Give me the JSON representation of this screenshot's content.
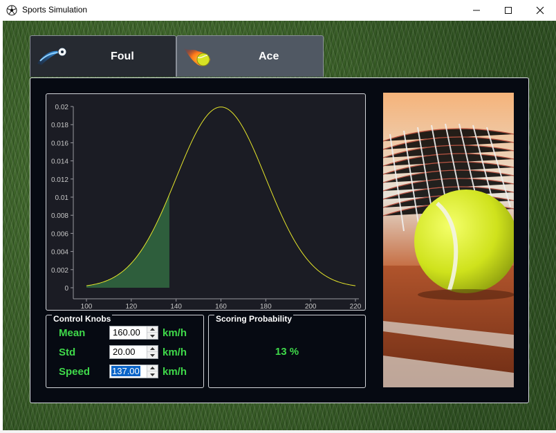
{
  "window": {
    "title": "Sports Simulation",
    "controls": [
      "minimize",
      "maximize",
      "close"
    ]
  },
  "tabs": [
    {
      "label": "Foul",
      "icon": "ball-comet-icon",
      "selected": true
    },
    {
      "label": "Ace",
      "icon": "flaming-tennis-ball-icon",
      "selected": false
    }
  ],
  "chart_data": {
    "type": "area",
    "title": "",
    "xlabel": "",
    "ylabel": "",
    "distribution": "normal",
    "mean": 160,
    "std": 20,
    "xlim": [
      100,
      220
    ],
    "ylim": [
      0,
      0.02
    ],
    "x_ticks": [
      100,
      120,
      140,
      160,
      180,
      200,
      220
    ],
    "x_tick_labels": [
      "100",
      "120",
      "140",
      "160",
      "180",
      "200",
      "220"
    ],
    "y_ticks": [
      0,
      0.002,
      0.004,
      0.006,
      0.008,
      0.01,
      0.012,
      0.014,
      0.016,
      0.018,
      0.02
    ],
    "y_tick_labels": [
      "0",
      "0.002",
      "0.004",
      "0.006",
      "0.008",
      "0.01",
      "0.012",
      "0.014",
      "0.016",
      "0.018",
      "0.02"
    ],
    "shaded_region": {
      "from": 100,
      "to": 137
    },
    "series": [
      {
        "values_x": [
          100,
          110,
          120,
          130,
          137,
          140,
          150,
          160,
          170,
          180,
          190,
          200,
          210,
          220
        ],
        "values_y": [
          0.0002,
          0.0008,
          0.0027,
          0.0065,
          0.0102,
          0.0121,
          0.0176,
          0.0199,
          0.0176,
          0.0121,
          0.0065,
          0.0027,
          0.0008,
          0.0002
        ]
      }
    ],
    "colors": {
      "curve": "#e8e82a",
      "fill": "#2e5e3c",
      "background": "#1b1c24",
      "axis": "#9a9aa0"
    }
  },
  "knobs": {
    "title": "Control Knobs",
    "items": [
      {
        "label": "Mean",
        "value": "160.00",
        "unit": "km/h"
      },
      {
        "label": "Std",
        "value": "20.00",
        "unit": "km/h"
      },
      {
        "label": "Speed",
        "value": "137.00",
        "unit": "km/h",
        "selected": true
      }
    ]
  },
  "probability": {
    "title": "Scoring Probability",
    "value": "13 %"
  },
  "photo": {
    "subject": "tennis-ball-and-racket-photo"
  },
  "colors": {
    "accent_green": "#3fd94a",
    "panel_bg": "#060a12"
  }
}
